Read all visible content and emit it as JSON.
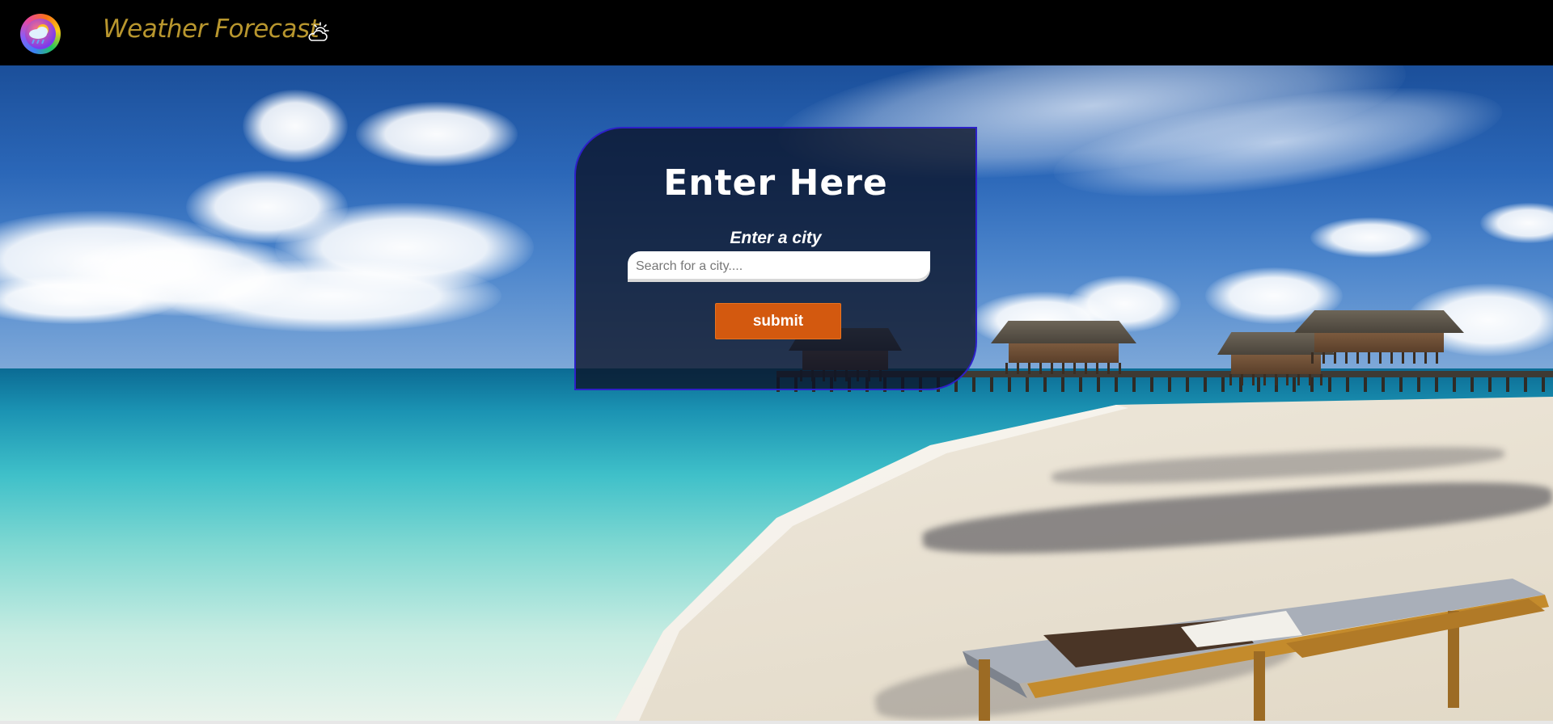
{
  "navbar": {
    "brand": "Weather Forecast",
    "logo_icon": "rain-cloud-sun-logo",
    "brand_icon": "partly-cloudy-icon"
  },
  "form": {
    "title": "Enter Here",
    "label": "Enter a city",
    "search_placeholder": "Search for a city....",
    "search_value": "",
    "submit_label": "submit"
  },
  "colors": {
    "navbar_bg": "#000000",
    "brand_text": "#b8962e",
    "card_border": "#2d20c8",
    "submit_bg": "#d3590f"
  },
  "background": {
    "icon": "tropical-beach-background"
  }
}
